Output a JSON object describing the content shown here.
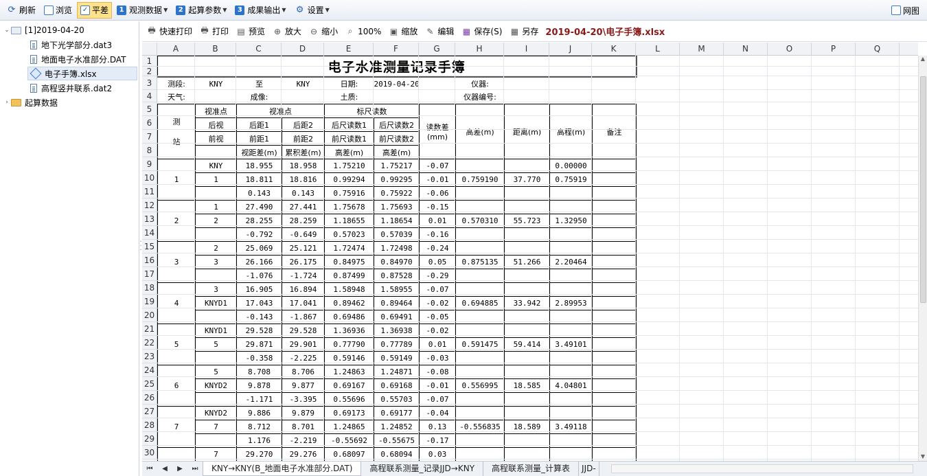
{
  "toolbar": {
    "refresh": "刷新",
    "browse": "浏览",
    "adjust": "平差",
    "observe": "观测数据",
    "observe_num": "1",
    "calc": "起算参数",
    "calc_num": "2",
    "output": "成果输出",
    "output_num": "3",
    "settings": "设置",
    "grid": "网图"
  },
  "tree": {
    "root": "[1]2019-04-20",
    "items": [
      "地下光学部分.dat3",
      "地面电子水准部分.DAT",
      "电子手簿.xlsx",
      "高程竖井联系.dat2"
    ],
    "calc": "起算数据"
  },
  "sheet_toolbar": {
    "quick_print": "快速打印",
    "print": "打印",
    "preview": "预览",
    "zoom_in": "放大",
    "zoom_out": "缩小",
    "zoom_100": "100%",
    "scale": "缩放",
    "edit": "编辑",
    "save": "保存(S)",
    "save_as": "另存",
    "file_title": "2019-04-20\\电子手簿.xlsx"
  },
  "columns": [
    "A",
    "B",
    "C",
    "D",
    "E",
    "F",
    "G",
    "H",
    "I",
    "J",
    "K",
    "L",
    "M",
    "N",
    "O",
    "P",
    "Q"
  ],
  "rows": [
    "1",
    "2",
    "3",
    "4",
    "5",
    "6",
    "7",
    "8",
    "9",
    "10",
    "11",
    "12",
    "13",
    "14",
    "15",
    "16",
    "17",
    "18",
    "19",
    "20",
    "21",
    "22",
    "23",
    "24",
    "25",
    "26",
    "27",
    "28",
    "29",
    "30"
  ],
  "book": {
    "title": "电子水准测量记录手簿",
    "r3": {
      "seg_label": "测段:",
      "seg_from": "KNY",
      "to": "至",
      "seg_to": "KNY",
      "date_label": "日期:",
      "date": "2019-04-20",
      "instr_label": "仪器:"
    },
    "r4": {
      "weather": "天气:",
      "image": "成像:",
      "soil": "土质:",
      "instr_no": "仪器编号:"
    },
    "head": {
      "station": "测\n\n站",
      "aim": "视准点",
      "aim2": "视准点",
      "staff": "标尺读数",
      "diff": "读数差\n(mm)",
      "hdiff": "高差(m)",
      "dist": "距离(m)",
      "elev": "高程(m)",
      "note": "备注",
      "back": "后视",
      "front": "前视",
      "bd1": "后距1",
      "bd2": "后距2",
      "fd1": "前距1",
      "fd2": "前距2",
      "sd": "视距差(m)",
      "acc": "累积差(m)",
      "br1": "后尺读数1",
      "br2": "后尺读数2",
      "fr1": "前尺读数1",
      "fr2": "前尺读数2",
      "h1": "高差(m)",
      "h2": "高差(m)"
    },
    "stations": [
      {
        "no": "1",
        "rows": [
          [
            "KNY",
            "18.955",
            "18.958",
            "1.75210",
            "1.75217",
            "-0.07"
          ],
          [
            "1",
            "18.811",
            "18.816",
            "0.99294",
            "0.99295",
            "-0.01"
          ],
          [
            "",
            "0.143",
            "0.143",
            "0.75916",
            "0.75922",
            "-0.06"
          ]
        ],
        "hdiff": "0.759190",
        "dist": "37.770",
        "elev_top": "0.00000",
        "elev": "0.75919"
      },
      {
        "no": "2",
        "rows": [
          [
            "1",
            "27.490",
            "27.441",
            "1.75678",
            "1.75693",
            "-0.15"
          ],
          [
            "2",
            "28.255",
            "28.259",
            "1.18655",
            "1.18654",
            "0.01"
          ],
          [
            "",
            "-0.792",
            "-0.649",
            "0.57023",
            "0.57039",
            "-0.16"
          ]
        ],
        "hdiff": "0.570310",
        "dist": "55.723",
        "elev_top": "",
        "elev": "1.32950"
      },
      {
        "no": "3",
        "rows": [
          [
            "2",
            "25.069",
            "25.121",
            "1.72474",
            "1.72498",
            "-0.24"
          ],
          [
            "3",
            "26.166",
            "26.175",
            "0.84975",
            "0.84970",
            "0.05"
          ],
          [
            "",
            "-1.076",
            "-1.724",
            "0.87499",
            "0.87528",
            "-0.29"
          ]
        ],
        "hdiff": "0.875135",
        "dist": "51.266",
        "elev_top": "",
        "elev": "2.20464"
      },
      {
        "no": "4",
        "rows": [
          [
            "3",
            "16.905",
            "16.894",
            "1.58948",
            "1.58955",
            "-0.07"
          ],
          [
            "KNYD1",
            "17.043",
            "17.041",
            "0.89462",
            "0.89464",
            "-0.02"
          ],
          [
            "",
            "-0.143",
            "-1.867",
            "0.69486",
            "0.69491",
            "-0.05"
          ]
        ],
        "hdiff": "0.694885",
        "dist": "33.942",
        "elev_top": "",
        "elev": "2.89953"
      },
      {
        "no": "5",
        "rows": [
          [
            "KNYD1",
            "29.528",
            "29.528",
            "1.36936",
            "1.36938",
            "-0.02"
          ],
          [
            "5",
            "29.871",
            "29.901",
            "0.77790",
            "0.77789",
            "0.01"
          ],
          [
            "",
            "-0.358",
            "-2.225",
            "0.59146",
            "0.59149",
            "-0.03"
          ]
        ],
        "hdiff": "0.591475",
        "dist": "59.414",
        "elev_top": "",
        "elev": "3.49101"
      },
      {
        "no": "6",
        "rows": [
          [
            "5",
            "8.708",
            "8.706",
            "1.24863",
            "1.24871",
            "-0.08"
          ],
          [
            "KNYD2",
            "9.878",
            "9.877",
            "0.69167",
            "0.69168",
            "-0.01"
          ],
          [
            "",
            "-1.171",
            "-3.395",
            "0.55696",
            "0.55703",
            "-0.07"
          ]
        ],
        "hdiff": "0.556995",
        "dist": "18.585",
        "elev_top": "",
        "elev": "4.04801"
      },
      {
        "no": "7",
        "rows": [
          [
            "KNYD2",
            "9.886",
            "9.879",
            "0.69173",
            "0.69177",
            "-0.04"
          ],
          [
            "7",
            "8.712",
            "8.701",
            "1.24865",
            "1.24852",
            "0.13"
          ],
          [
            "",
            "1.176",
            "-2.219",
            "-0.55692",
            "-0.55675",
            "-0.17"
          ]
        ],
        "hdiff": "-0.556835",
        "dist": "18.589",
        "elev_top": "",
        "elev": "3.49118"
      }
    ],
    "last_row": [
      "7",
      "29.270",
      "29.276",
      "0.68097",
      "0.68094",
      "0.03"
    ]
  },
  "tabs": [
    "KNY→KNY(B_地面电子水准部分.DAT)",
    "高程联系测量_记录JJD→KNY",
    "高程联系测量_计算表",
    "JJD-"
  ]
}
